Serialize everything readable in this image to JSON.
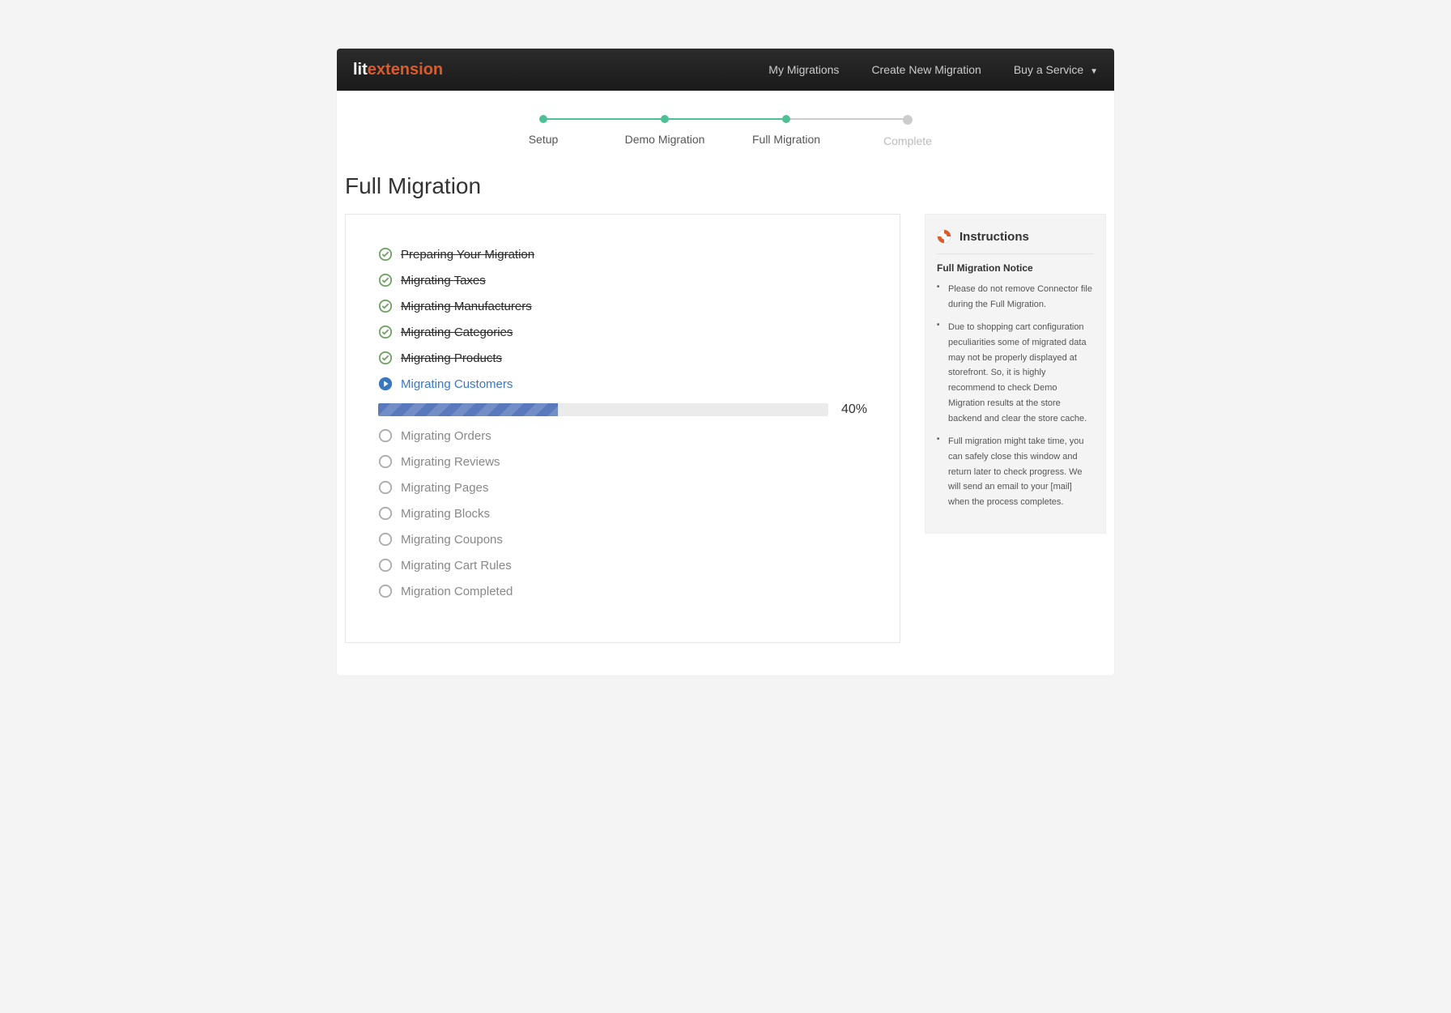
{
  "logo": {
    "part1": "lit",
    "part2": "extension"
  },
  "nav": {
    "my_migrations": "My Migrations",
    "create": "Create New Migration",
    "buy": "Buy a Service"
  },
  "steps": [
    {
      "label": "Setup"
    },
    {
      "label": "Demo Migration"
    },
    {
      "label": "Full Migration"
    },
    {
      "label": "Complete"
    }
  ],
  "page_title": "Full Migration",
  "tasks": [
    {
      "label": "Preparing Your Migration"
    },
    {
      "label": "Migrating Taxes"
    },
    {
      "label": "Migrating Manufacturers"
    },
    {
      "label": "Migrating Categories"
    },
    {
      "label": "Migrating Products"
    },
    {
      "label": "Migrating Customers"
    },
    {
      "label": "Migrating Orders"
    },
    {
      "label": "Migrating Reviews"
    },
    {
      "label": "Migrating Pages"
    },
    {
      "label": "Migrating Blocks"
    },
    {
      "label": "Migrating Coupons"
    },
    {
      "label": "Migrating Cart Rules"
    },
    {
      "label": "Migration Completed"
    }
  ],
  "progress": {
    "pct_label": "40%",
    "pct_value": 40
  },
  "instructions": {
    "title": "Instructions",
    "subtitle": "Full Migration Notice",
    "items": [
      "Please do not remove Connector file during the Full Migration.",
      "Due to shopping cart configuration peculiarities some of migrated data may not be properly displayed at storefront. So, it is highly recommend to check Demo Migration results at the store backend and clear the store cache.",
      "Full migration might take time, you can safely close this window and return later to check progress. We will send an email to your [mail] when the process completes."
    ]
  }
}
